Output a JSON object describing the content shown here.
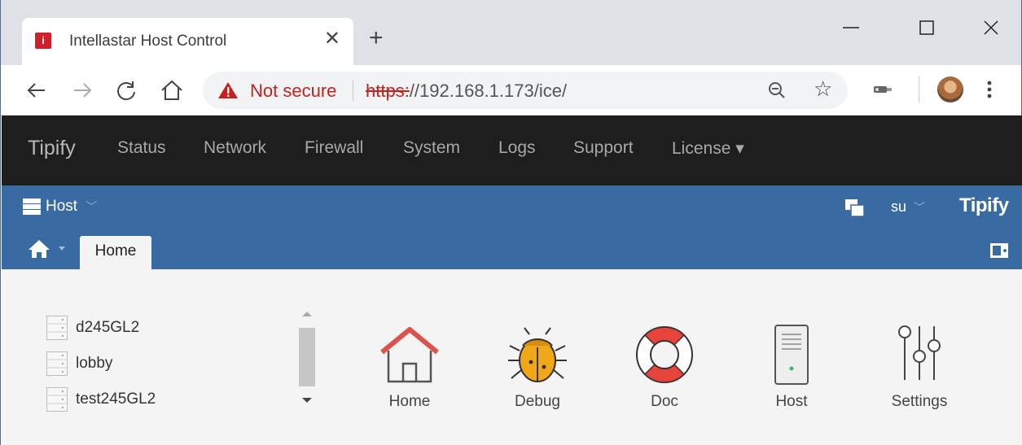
{
  "browser": {
    "tab_title": "Intellastar Host Control",
    "tab_favicon_letter": "i",
    "security_label": "Not secure",
    "url_scheme": "https:",
    "url_rest": "//192.168.1.173/ice/"
  },
  "navbar": {
    "brand": "Tipify",
    "items": [
      {
        "label": "Status"
      },
      {
        "label": "Network"
      },
      {
        "label": "Firewall"
      },
      {
        "label": "System"
      },
      {
        "label": "Logs"
      },
      {
        "label": "Support"
      },
      {
        "label": "License ▾"
      }
    ]
  },
  "subbar": {
    "host_label": "Host",
    "user_label": "su",
    "logo": "Tipify",
    "home_tab": "Home"
  },
  "hosts": [
    {
      "name": "d245GL2"
    },
    {
      "name": "lobby"
    },
    {
      "name": "test245GL2"
    }
  ],
  "tiles": [
    {
      "label": "Home"
    },
    {
      "label": "Debug"
    },
    {
      "label": "Doc"
    },
    {
      "label": "Host"
    },
    {
      "label": "Settings"
    }
  ],
  "colors": {
    "navbar_bg": "#1e1e1e",
    "accent_blue": "#3a6aa2",
    "insecure_red": "#c5221f"
  }
}
